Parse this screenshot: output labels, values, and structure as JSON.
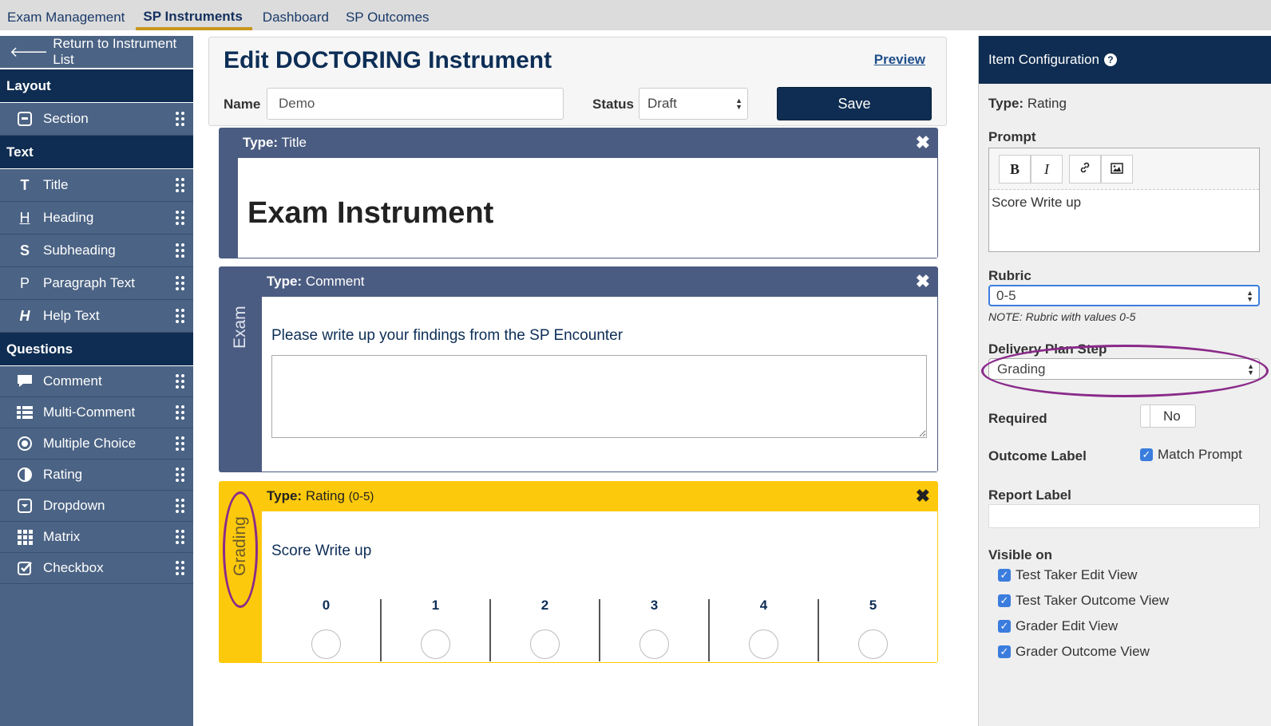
{
  "topnav": {
    "tabs": [
      {
        "label": "Exam Management"
      },
      {
        "label": "SP Instruments"
      },
      {
        "label": "Dashboard"
      },
      {
        "label": "SP Outcomes"
      }
    ]
  },
  "sidebar": {
    "return_label": "Return to Instrument List",
    "sections": [
      {
        "title": "Layout",
        "items": [
          {
            "label": "Section",
            "icon": "section-icon"
          }
        ]
      },
      {
        "title": "Text",
        "items": [
          {
            "label": "Title",
            "icon": "T"
          },
          {
            "label": "Heading",
            "icon": "H"
          },
          {
            "label": "Subheading",
            "icon": "S"
          },
          {
            "label": "Paragraph Text",
            "icon": "P"
          },
          {
            "label": "Help Text",
            "icon": "H"
          }
        ]
      },
      {
        "title": "Questions",
        "items": [
          {
            "label": "Comment",
            "icon": "comment-icon"
          },
          {
            "label": "Multi-Comment",
            "icon": "list-icon"
          },
          {
            "label": "Multiple Choice",
            "icon": "radio-icon"
          },
          {
            "label": "Rating",
            "icon": "half-circle-icon"
          },
          {
            "label": "Dropdown",
            "icon": "dropdown-icon"
          },
          {
            "label": "Matrix",
            "icon": "grid-icon"
          },
          {
            "label": "Checkbox",
            "icon": "checkbox-icon"
          }
        ]
      }
    ]
  },
  "editor": {
    "title": "Edit DOCTORING Instrument",
    "preview_label": "Preview",
    "name_label": "Name",
    "name_value": "Demo",
    "status_label": "Status",
    "status_value": "Draft",
    "save_label": "Save"
  },
  "cards": {
    "title_card": {
      "type_label": "Type:",
      "type_value": "Title",
      "content": "Exam Instrument"
    },
    "comment_card": {
      "type_label": "Type:",
      "type_value": "Comment",
      "side_label": "Exam",
      "prompt": "Please write up your findings from the SP Encounter"
    },
    "rating_card": {
      "type_label": "Type:",
      "type_value": "Rating",
      "type_suffix": "(0-5)",
      "side_label": "Grading",
      "prompt": "Score Write up",
      "scale": [
        "0",
        "1",
        "2",
        "3",
        "4",
        "5"
      ]
    }
  },
  "config": {
    "header": "Item Configuration",
    "type_label": "Type:",
    "type_value": "Rating",
    "prompt_label": "Prompt",
    "prompt_value": "Score Write up",
    "rubric_label": "Rubric",
    "rubric_value": "0-5",
    "rubric_note": "NOTE: Rubric with values 0-5",
    "delivery_label": "Delivery Plan Step",
    "delivery_value": "Grading",
    "required_label": "Required",
    "required_value": "No",
    "outcome_label": "Outcome Label",
    "match_prompt_label": "Match Prompt",
    "report_label": "Report Label",
    "visible_on_label": "Visible on",
    "visible_on": [
      "Test Taker Edit View",
      "Test Taker Outcome View",
      "Grader Edit View",
      "Grader Outcome View"
    ]
  },
  "colors": {
    "navy": "#0f2d52",
    "sidebar": "#4b6384",
    "card_header": "#4b5c82",
    "rating_yellow": "#fdc90c",
    "annotation_purple": "#8a2a8a",
    "accent_gold": "#c9961e"
  }
}
